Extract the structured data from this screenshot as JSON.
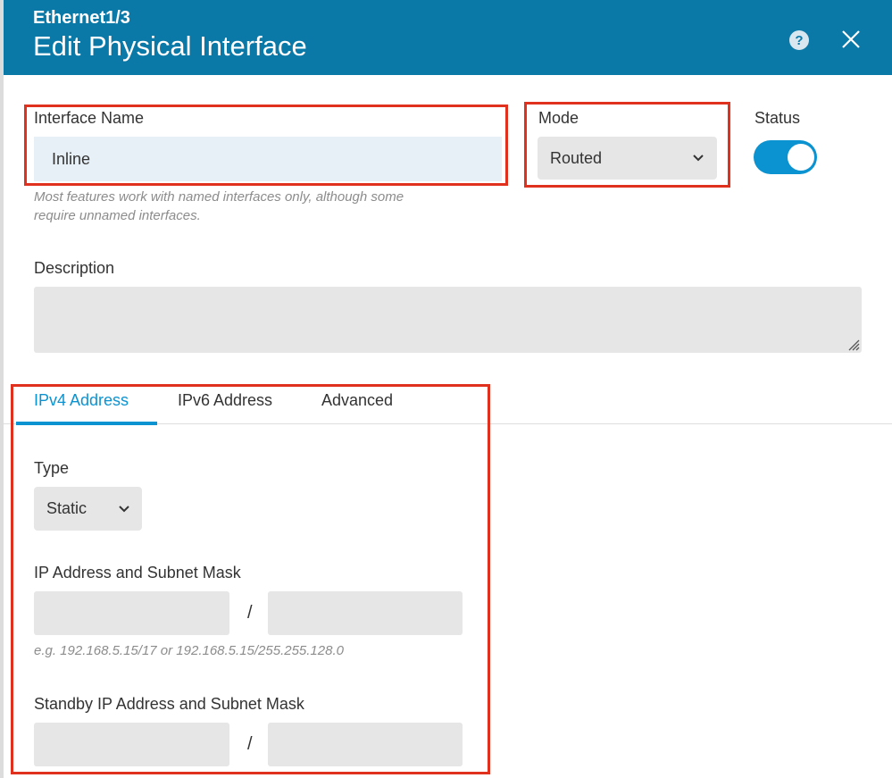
{
  "header": {
    "subtitle": "Ethernet1/3",
    "title": "Edit Physical Interface",
    "help_icon": "help-icon",
    "close_icon": "close-icon",
    "color": "#0b79a8"
  },
  "interface_name": {
    "label": "Interface Name",
    "value": "Inline",
    "hint_line1": "Most features work with named interfaces only, although some",
    "hint_line2": "require unnamed interfaces."
  },
  "mode": {
    "label": "Mode",
    "selected": "Routed"
  },
  "status": {
    "label": "Status",
    "enabled": true,
    "color": "#0b93d1"
  },
  "description": {
    "label": "Description",
    "value": ""
  },
  "tabs": [
    {
      "label": "IPv4 Address",
      "active": true
    },
    {
      "label": "IPv6 Address",
      "active": false
    },
    {
      "label": "Advanced",
      "active": false
    }
  ],
  "ipv4": {
    "type_label": "Type",
    "type_selected": "Static",
    "ip_label": "IP Address and Subnet Mask",
    "ip_separator": "/",
    "ip_hint": "e.g. 192.168.5.15/17 or 192.168.5.15/255.255.128.0",
    "standby_label": "Standby IP Address and Subnet Mask",
    "standby_separator": "/"
  },
  "highlight_color": "#e0301e"
}
